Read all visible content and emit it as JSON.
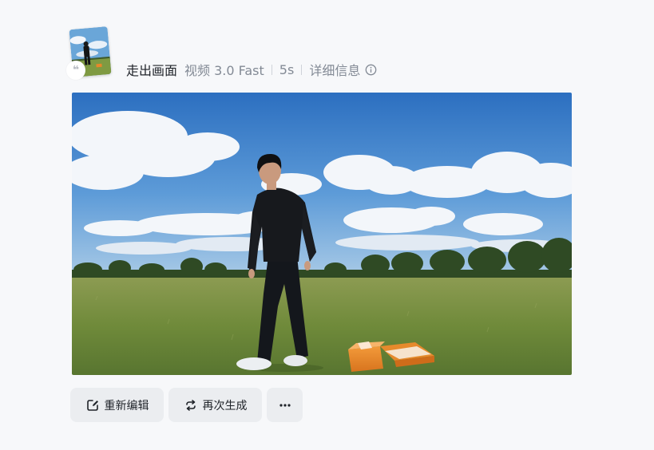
{
  "header": {
    "title": "走出画面",
    "model": "视频 3.0 Fast",
    "duration": "5s",
    "details_label": "详细信息",
    "quote_glyph": "❝"
  },
  "actions": {
    "reedit_label": "重新编辑",
    "regenerate_label": "再次生成",
    "more_label": "···"
  },
  "icons": {
    "info": "info-icon",
    "reedit": "edit-icon",
    "regenerate": "refresh-icon",
    "more": "more-icon",
    "quote": "quote-icon"
  },
  "colors": {
    "page_bg": "#f7f8fa",
    "button_bg": "#ebedf0",
    "text_primary": "#1f2329",
    "text_secondary": "#838a95"
  }
}
